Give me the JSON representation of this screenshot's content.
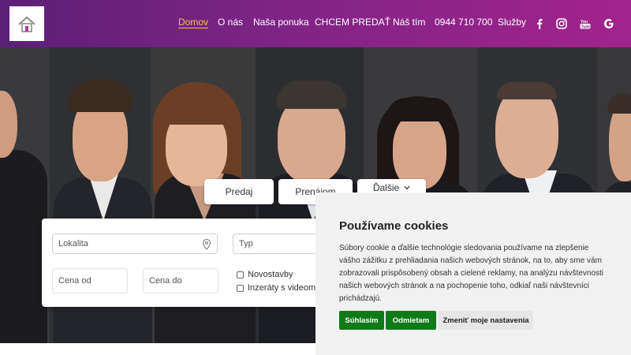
{
  "nav": {
    "items": [
      "Domov",
      "O nás",
      "Naša ponuka",
      "CHCEM PREDAŤ",
      "Náš tím",
      "0944 710 700",
      "Služby"
    ],
    "active_color": "#f6c24a",
    "social_icons": [
      "facebook-icon",
      "instagram-icon",
      "youtube-icon",
      "google-icon"
    ]
  },
  "header": {
    "gradient": [
      "#5c1f78",
      "#a3238c"
    ]
  },
  "tabs": {
    "sell": "Predaj",
    "rent": "Prenájom",
    "more": "Ďalšie"
  },
  "search": {
    "location_placeholder": "Lokalita",
    "type_placeholder": "Typ",
    "price_from_placeholder": "Cena od",
    "price_to_placeholder": "Cena do",
    "checkbox_new_buildings": "Novostavby",
    "checkbox_video": "Inzeráty s videom"
  },
  "cookie": {
    "title": "Používame cookies",
    "text": "Súbory cookie a ďalšie technológie sledovania používame na zlepšenie vášho zážitku z prehliadania našich webových stránok, na to, aby sme vám zobrazovali prispôsobený obsah a cielené reklamy, na analýzu návštevnosti našich webových stránok a na pochopenie toho, odkiaľ naši návštevníci prichádzajú.",
    "accept": "Súhlasím",
    "reject": "Odmietam",
    "settings": "Zmeniť moje nastavenia",
    "button_color": "#0f7a17"
  }
}
